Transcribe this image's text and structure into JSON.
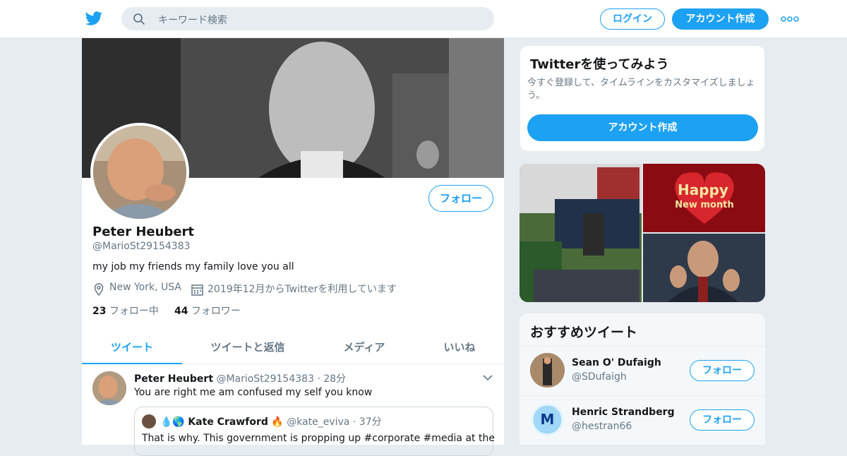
{
  "header": {
    "search_placeholder": "キーワード検索",
    "login": "ログイン",
    "signup": "アカウント作成"
  },
  "profile": {
    "follow_button": "フォロー",
    "name": "Peter Heubert",
    "handle": "@MarioSt29154383",
    "bio": "my job my friends my family love you all",
    "location": "New York, USA",
    "joined": "2019年12月からTwitterを利用しています",
    "following_count": "23",
    "following_label": "フォロー中",
    "followers_count": "44",
    "followers_label": "フォロワー"
  },
  "tabs": [
    "ツイート",
    "ツイートと返信",
    "メディア",
    "いいね"
  ],
  "tweet": {
    "name": "Peter Heubert",
    "handle": "@MarioSt29154383",
    "time": "28分",
    "text": "You are right me am confused my self you know",
    "quote": {
      "emoji_prefix": "💧🌎",
      "name": "Kate Crawford",
      "emoji_suffix": "🔥",
      "handle": "@kate_eviva",
      "time": "37分",
      "text": "That is why. This government is propping up #corporate #media at the"
    }
  },
  "sidebar": {
    "promo_title": "Twitterを使ってみよう",
    "promo_text": "今すぐ登録して、タイムラインをカスタマイズしましょう。",
    "promo_button": "アカウント作成",
    "media_overlay": "Happy\nNew month",
    "rec_title": "おすすめツイート",
    "rec_users": [
      {
        "name": "Sean O' Dufaigh",
        "handle": "@SDufaigh",
        "button": "フォロー"
      },
      {
        "name": "Henric Strandberg",
        "handle": "@hestran66",
        "button": "フォロー"
      }
    ]
  },
  "colors": {
    "accent": "#1da1f2",
    "muted": "#657786",
    "bg": "#e6ecf0"
  }
}
